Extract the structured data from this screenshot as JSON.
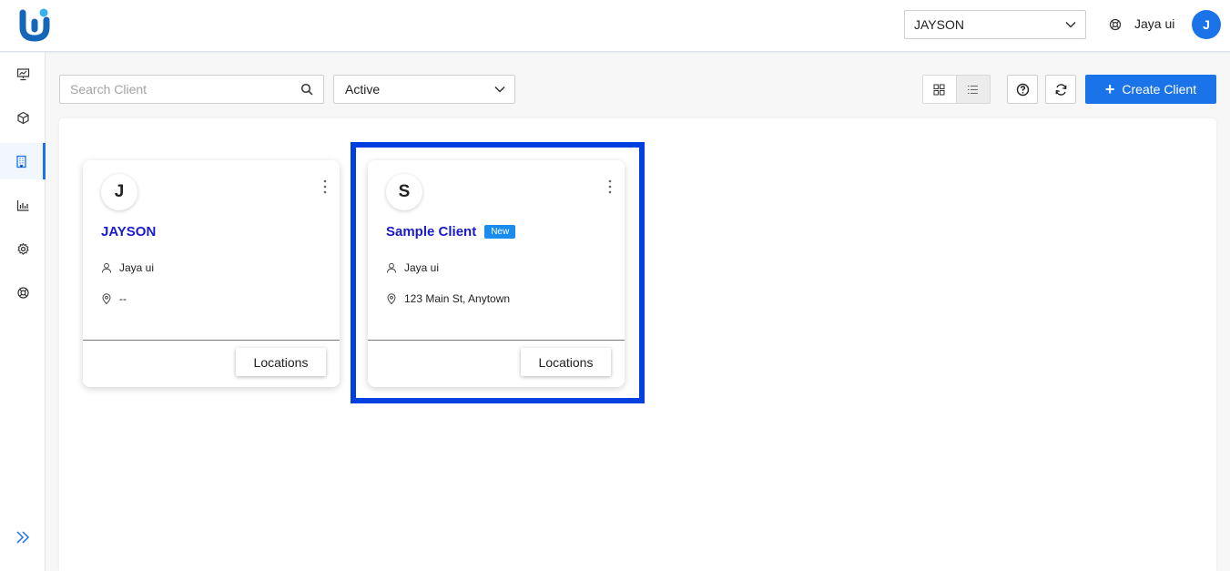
{
  "header": {
    "logo_icon": "brand-logo-icon",
    "org_select": {
      "value": "JAYSON",
      "icon": "chevron-down-icon"
    },
    "support_icon": "lifebuoy-icon",
    "user_name": "Jaya ui",
    "avatar_initial": "J"
  },
  "sidebar": {
    "items": [
      {
        "icon": "presentation-chart-icon"
      },
      {
        "icon": "cube-icon"
      },
      {
        "icon": "building-icon",
        "active": true
      },
      {
        "icon": "bar-chart-icon"
      },
      {
        "icon": "gear-icon"
      },
      {
        "icon": "lifebuoy-icon"
      }
    ],
    "expand_icon": "double-chevron-right-icon"
  },
  "toolbar": {
    "search_placeholder": "Search Client",
    "search_icon": "search-icon",
    "status_value": "Active",
    "grid_view_icon": "grid-icon",
    "list_view_icon": "list-icon",
    "help_icon": "question-circle-icon",
    "refresh_icon": "refresh-icon",
    "create_label": "Create Client"
  },
  "clients": [
    {
      "initial": "J",
      "name": "JAYSON",
      "badge": "",
      "owner": "Jaya ui",
      "address": "--",
      "locations_label": "Locations"
    },
    {
      "initial": "S",
      "name": "Sample Client",
      "badge": "New",
      "owner": "Jaya ui",
      "address": "123 Main St, Anytown",
      "locations_label": "Locations"
    }
  ],
  "colors": {
    "accent": "#1a73e8",
    "title": "#1a1aca",
    "badge": "#1a8cf0",
    "highlight": "#0040e0"
  }
}
